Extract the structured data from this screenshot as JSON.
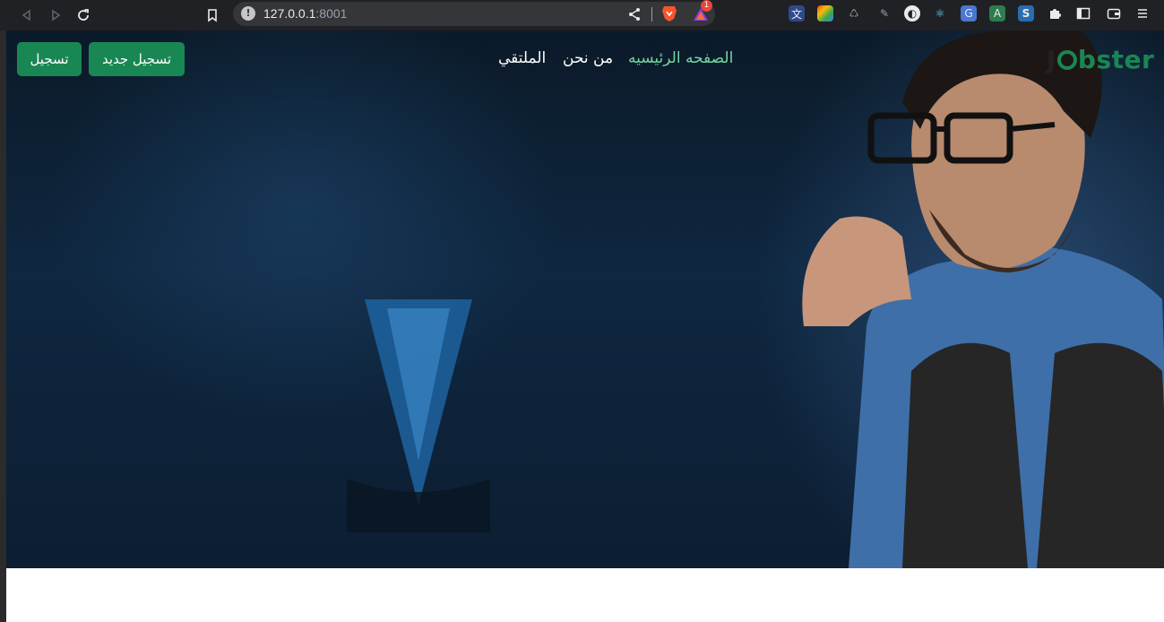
{
  "browser": {
    "url_host": "127.0.0.1",
    "url_port": ":8001",
    "rewards_badge": "1",
    "icons": {
      "back": "back-icon",
      "forward": "forward-icon",
      "reload": "reload-icon",
      "bookmark": "bookmark-icon",
      "info": "site-info-icon",
      "share": "share-icon"
    }
  },
  "navbar": {
    "logo_pre": "J",
    "logo_post": "bster",
    "links": [
      {
        "label": "الصفحه الرئيسيه",
        "active": true
      },
      {
        "label": "من نحن",
        "active": false
      },
      {
        "label": "الملتقي",
        "active": false
      }
    ],
    "signup_label": "تسجيل جديد",
    "login_label": "تسجيل"
  },
  "colors": {
    "brand_green": "#198754",
    "active_link": "#75d5a1",
    "toolbar_bg": "#202124"
  }
}
